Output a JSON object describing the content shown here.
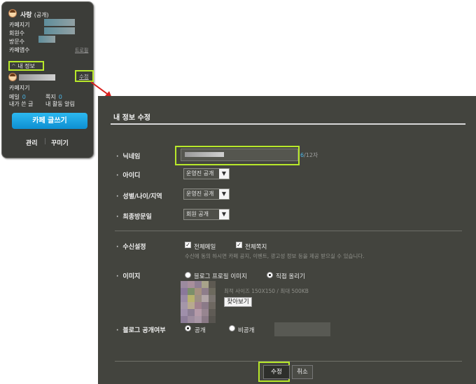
{
  "sidebar": {
    "cafe_name": "사랑",
    "visibility": "(공개)",
    "rows": [
      "카페지기",
      "회원수",
      "방문수",
      "카페앱수"
    ],
    "rank_link": "트로필",
    "my_info_label": "내 정보",
    "edit_link": "수정",
    "member_role": "카페지기",
    "mail_label": "메일",
    "mail_count": "0",
    "note_label": "쪽지",
    "note_count": "0",
    "my_posts_label": "내가 쓴 글",
    "my_activity_label": "내 활동 알림",
    "write_button": "카페 글쓰기",
    "manage_link": "관리",
    "decorate_link": "꾸미기"
  },
  "dialog": {
    "title": "내 정보 수정",
    "nickname": {
      "label": "닉네임",
      "counter_current": "6",
      "counter_max": "/12자"
    },
    "id_field": {
      "label": "아이디",
      "value": "운영진 공개"
    },
    "profile_field": {
      "label": "성별/나이/지역",
      "value": "운영진 공개"
    },
    "last_visit_field": {
      "label": "최종방문일",
      "value": "회원 공개"
    },
    "receive": {
      "label": "수신설정",
      "opt_mail": "전체메일",
      "opt_note": "전체쪽지",
      "hint": "수신에 동의 하시면 카페 공지, 이벤트, 광고성 정보 등을 제공 받으실 수 있습니다."
    },
    "image": {
      "label": "이미지",
      "opt_blog": "블로그 프로필 이미지",
      "opt_upload": "직접 올리기",
      "size_hint": "최적 사이즈 150X150 / 최대 500KB",
      "browse_button": "찾아보기"
    },
    "blog_public": {
      "label": "블로그 공개여부",
      "opt_public": "공개",
      "opt_private": "비공개"
    },
    "submit_button": "수정",
    "cancel_button": "취소"
  },
  "colors": {
    "panel_bg": "#3c3d39",
    "dialog_bg": "#43443e",
    "highlight": "#b8e82a",
    "accent_blue": "#4ab6e8",
    "arrow": "#d9201e"
  }
}
